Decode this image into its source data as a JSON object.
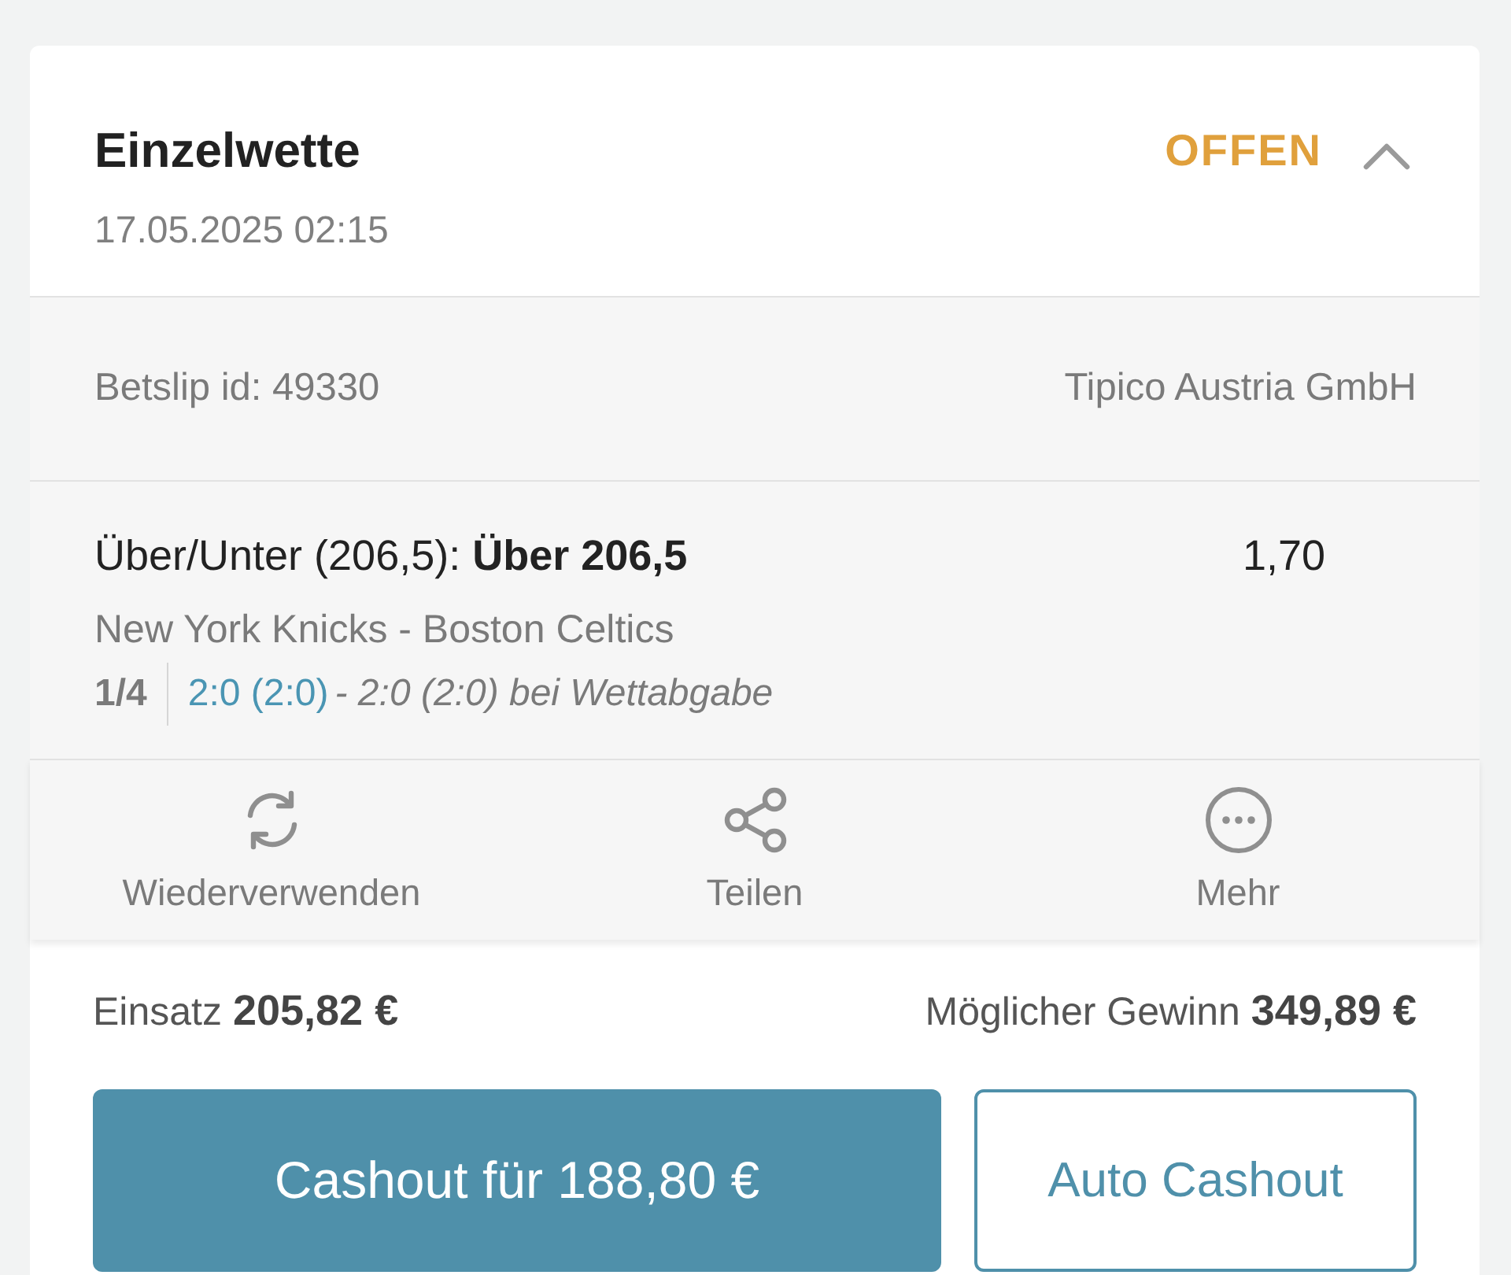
{
  "header": {
    "title": "Einzelwette",
    "date": "17.05.2025 02:15",
    "status": "OFFEN",
    "expanded": true
  },
  "info": {
    "betslip_id": "Betslip id: 49330",
    "provider": "Tipico Austria GmbH"
  },
  "selection": {
    "market": "Über/Unter (206,5): **Über 206,5**",
    "odds": "1,70",
    "event": "New York Knicks - Boston Celtics",
    "period": "1/4",
    "live_score": "2:0 (2:0)",
    "score_at_bet": "- 2:0 (2:0) bei Wettabgabe"
  },
  "actions": [
    {
      "kind": "reuse",
      "label": "Wiederverwenden"
    },
    {
      "kind": "share",
      "label": "Teilen"
    },
    {
      "kind": "more",
      "label": "Mehr"
    }
  ],
  "summary": {
    "stake_label": "Einsatz",
    "stake_value": "205,82 €",
    "win_label": "Möglicher Gewinn",
    "win_value": "349,89 €"
  },
  "buttons": [
    {
      "kind": "primary",
      "label": "Cashout für 188,80 €"
    },
    {
      "kind": "outline",
      "label": "Auto Cashout"
    }
  ]
}
